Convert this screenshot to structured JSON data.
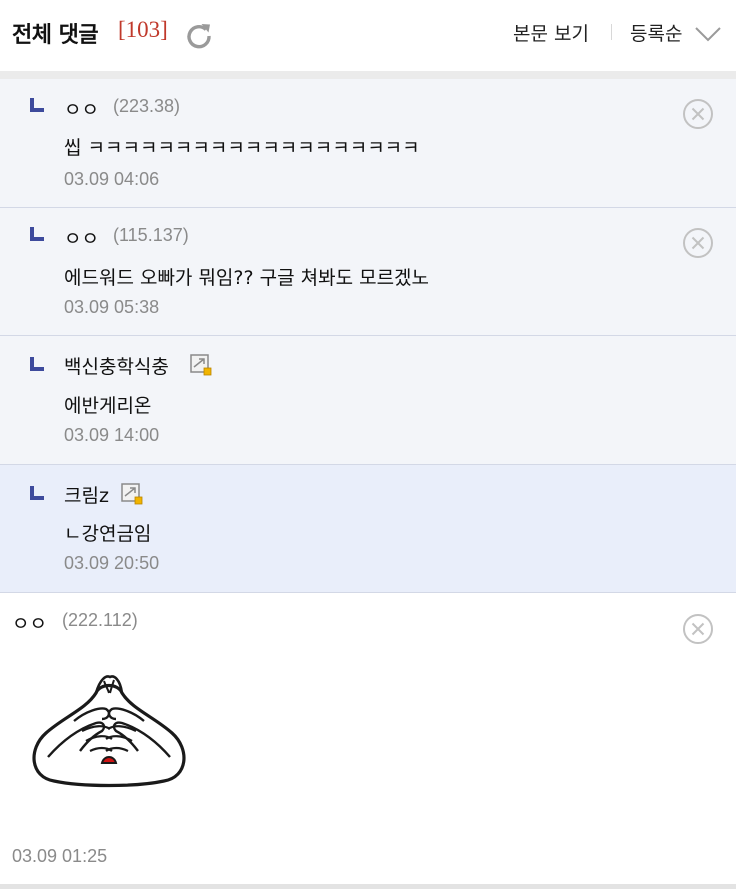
{
  "header": {
    "title": "전체 댓글",
    "count": "[103]",
    "view_label": "본문 보기",
    "sort_label": "등록순"
  },
  "replies": [
    {
      "nick": "ㅇㅇ",
      "ip": "(223.38)",
      "text": "씹 ㅋㅋㅋㅋㅋㅋㅋㅋㅋㅋㅋㅋㅋㅋㅋㅋㅋㅋㅋ",
      "date": "03.09 04:06"
    },
    {
      "nick": "ㅇㅇ",
      "ip": "(115.137)",
      "text": "에드워드 오빠가 뭐임?? 구글 쳐봐도 모르겠노",
      "date": "03.09 05:38"
    },
    {
      "nick": "백신충학식충",
      "text": "에반게리온",
      "date": "03.09 14:00"
    },
    {
      "nick": "크림z",
      "text": "ㄴ강연금임",
      "date": "03.09 20:50"
    }
  ],
  "comment": {
    "nick": "ㅇㅇ",
    "ip": "(222.112)",
    "date": "03.09 01:25"
  },
  "colors": {
    "count": "#c0392b",
    "reply_bg": "#f3f5f9",
    "reply_highlight_bg": "#e9eefa",
    "reply_mark": "#3d4a9c"
  }
}
